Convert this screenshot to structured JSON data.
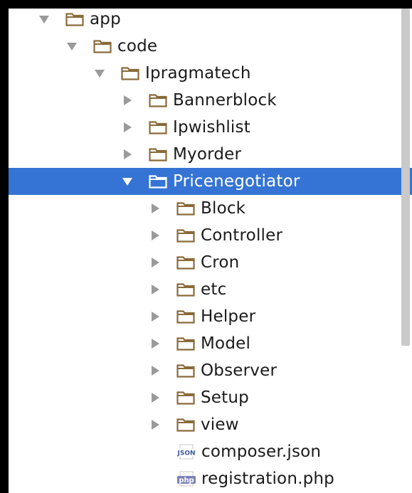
{
  "tree": [
    {
      "label": "app",
      "depth": 0,
      "expanded": true,
      "type": "folder"
    },
    {
      "label": "code",
      "depth": 1,
      "expanded": true,
      "type": "folder"
    },
    {
      "label": "Ipragmatech",
      "depth": 2,
      "expanded": true,
      "type": "folder"
    },
    {
      "label": "Bannerblock",
      "depth": 3,
      "expanded": false,
      "type": "folder"
    },
    {
      "label": "Ipwishlist",
      "depth": 3,
      "expanded": false,
      "type": "folder"
    },
    {
      "label": "Myorder",
      "depth": 3,
      "expanded": false,
      "type": "folder"
    },
    {
      "label": "Pricenegotiator",
      "depth": 3,
      "expanded": true,
      "type": "folder",
      "selected": true
    },
    {
      "label": "Block",
      "depth": 4,
      "expanded": false,
      "type": "folder"
    },
    {
      "label": "Controller",
      "depth": 4,
      "expanded": false,
      "type": "folder"
    },
    {
      "label": "Cron",
      "depth": 4,
      "expanded": false,
      "type": "folder"
    },
    {
      "label": "etc",
      "depth": 4,
      "expanded": false,
      "type": "folder"
    },
    {
      "label": "Helper",
      "depth": 4,
      "expanded": false,
      "type": "folder"
    },
    {
      "label": "Model",
      "depth": 4,
      "expanded": false,
      "type": "folder"
    },
    {
      "label": "Observer",
      "depth": 4,
      "expanded": false,
      "type": "folder"
    },
    {
      "label": "Setup",
      "depth": 4,
      "expanded": false,
      "type": "folder"
    },
    {
      "label": "view",
      "depth": 4,
      "expanded": false,
      "type": "folder"
    },
    {
      "label": "composer.json",
      "depth": 4,
      "type": "file",
      "icon": "json-file-icon",
      "badge": "JSON"
    },
    {
      "label": "registration.php",
      "depth": 4,
      "type": "file",
      "icon": "php-file-icon",
      "badge": "php"
    }
  ],
  "colors": {
    "selection": "#3574d4",
    "folder_stroke": "#8a6a3a",
    "arrow": "#9a9a9a"
  }
}
